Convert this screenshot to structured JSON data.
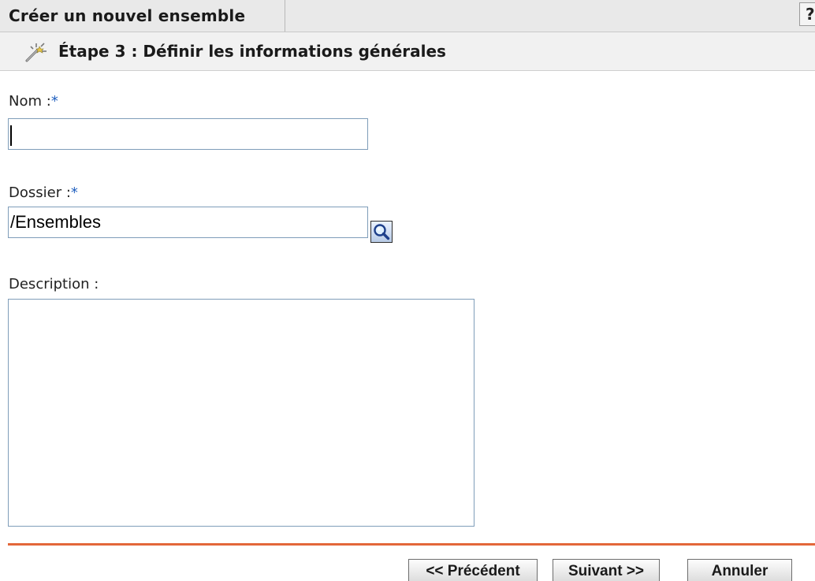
{
  "header": {
    "title": "Créer un nouvel ensemble",
    "help_label": "?"
  },
  "step": {
    "icon": "wizard-wand-icon",
    "label": "Étape 3 : Définir les informations générales"
  },
  "form": {
    "name": {
      "label": "Nom :",
      "required_marker": "*",
      "value": ""
    },
    "folder": {
      "label": "Dossier :",
      "required_marker": "*",
      "value": "/Ensembles",
      "browse_icon": "search-icon"
    },
    "description": {
      "label": "Description :",
      "value": ""
    }
  },
  "footer": {
    "previous_label": "<< Précédent",
    "next_label": "Suivant >>",
    "cancel_label": "Annuler"
  },
  "colors": {
    "divider": "#e3673a",
    "required": "#1f5fbf",
    "input_border": "#7f9db9"
  }
}
